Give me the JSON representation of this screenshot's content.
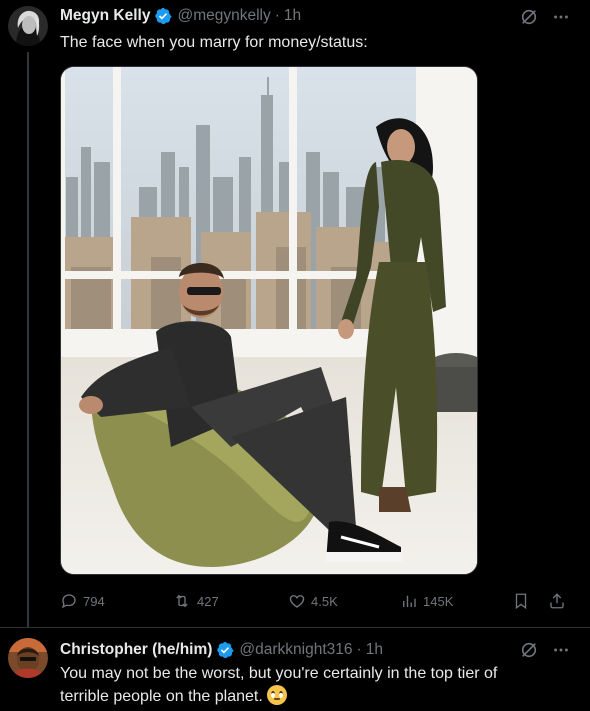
{
  "tweet": {
    "author_name": "Megyn Kelly",
    "handle": "@megynkelly",
    "separator": "·",
    "time": "1h",
    "text": "The face when you marry for money/status:",
    "actions": {
      "replies": "794",
      "reposts": "427",
      "likes": "4.5K",
      "views": "145K"
    }
  },
  "reply": {
    "author_name": "Christopher (he/him)",
    "handle": "@darkknight316",
    "separator": "·",
    "time": "1h",
    "text_line1": "You may not be the worst, but you're certainly in the top tier of",
    "text_line2": "terrible people on the planet.",
    "emoji": "rolling-eyes-emoji"
  },
  "colors": {
    "background": "#000000",
    "text_primary": "#e7e9ea",
    "text_secondary": "#71767b",
    "verified_badge": "#1d9bf0",
    "divider": "#2f3336"
  },
  "icons": [
    "verified-badge-icon",
    "grok-icon",
    "more-icon",
    "reply-icon",
    "repost-icon",
    "like-icon",
    "views-icon",
    "bookmark-icon",
    "share-icon"
  ]
}
